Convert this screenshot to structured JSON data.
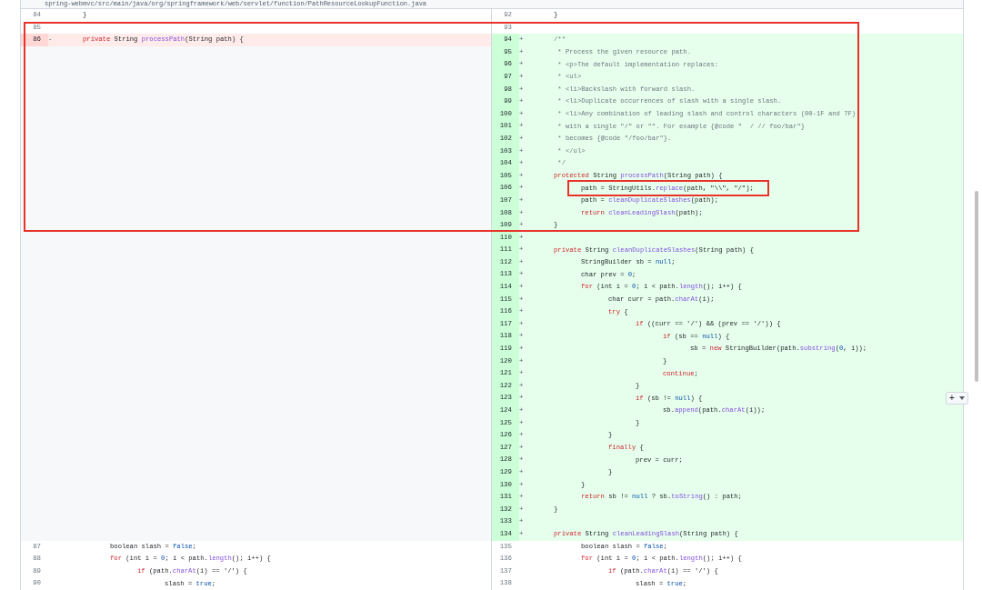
{
  "file_header": {
    "path": "spring-webmvc/src/main/java/org/springframework/web/servlet/function/PathResourceLookupFunction.java"
  },
  "rows": [
    {
      "left": {
        "kind": "context",
        "number": "84",
        "code": [
          {
            "kind": "plain",
            "text": "\t}"
          }
        ]
      },
      "right": {
        "kind": "context",
        "number": "92",
        "code": [
          {
            "kind": "plain",
            "text": "\t}"
          }
        ]
      }
    },
    {
      "left": {
        "kind": "context",
        "number": "85"
      },
      "right": {
        "kind": "context",
        "number": "93"
      }
    },
    {
      "left": {
        "kind": "deleted",
        "number": "86",
        "marker": "-",
        "code": [
          {
            "kind": "keyword",
            "text": "\tprivate"
          },
          {
            "kind": "plain",
            "text": " String "
          },
          {
            "kind": "method",
            "text": "processPath"
          },
          {
            "kind": "plain",
            "text": "(String path) {"
          }
        ]
      },
      "right": {
        "kind": "added",
        "number": "94",
        "marker": "+",
        "code": [
          {
            "kind": "comment",
            "text": "\t/**"
          }
        ]
      }
    },
    {
      "left": {
        "kind": "empty"
      },
      "right": {
        "kind": "added",
        "number": "95",
        "marker": "+",
        "code": [
          {
            "kind": "comment",
            "text": "\t * Process the given resource path."
          }
        ]
      }
    },
    {
      "left": {
        "kind": "empty"
      },
      "right": {
        "kind": "added",
        "number": "96",
        "marker": "+",
        "code": [
          {
            "kind": "comment",
            "text": "\t * <p>The default implementation replaces:"
          }
        ]
      }
    },
    {
      "left": {
        "kind": "empty"
      },
      "right": {
        "kind": "added",
        "number": "97",
        "marker": "+",
        "code": [
          {
            "kind": "comment",
            "text": "\t * <ul>"
          }
        ]
      }
    },
    {
      "left": {
        "kind": "empty"
      },
      "right": {
        "kind": "added",
        "number": "98",
        "marker": "+",
        "code": [
          {
            "kind": "comment",
            "text": "\t * <li>Backslash with forward slash."
          }
        ]
      }
    },
    {
      "left": {
        "kind": "empty"
      },
      "right": {
        "kind": "added",
        "number": "99",
        "marker": "+",
        "code": [
          {
            "kind": "comment",
            "text": "\t * <li>Duplicate occurrences of slash with a single slash."
          }
        ]
      }
    },
    {
      "left": {
        "kind": "empty"
      },
      "right": {
        "kind": "added",
        "number": "100",
        "marker": "+",
        "code": [
          {
            "kind": "comment",
            "text": "\t * <li>Any combination of leading slash and control characters (00-1F and 7F)"
          }
        ]
      }
    },
    {
      "left": {
        "kind": "empty"
      },
      "right": {
        "kind": "added",
        "number": "101",
        "marker": "+",
        "code": [
          {
            "kind": "comment",
            "text": "\t * with a single \"/\" or \"\". For example {@code \"  / // foo/bar\"}"
          }
        ]
      }
    },
    {
      "left": {
        "kind": "empty"
      },
      "right": {
        "kind": "added",
        "number": "102",
        "marker": "+",
        "code": [
          {
            "kind": "comment",
            "text": "\t * becomes {@code \"/foo/bar\"}."
          }
        ]
      }
    },
    {
      "left": {
        "kind": "empty"
      },
      "right": {
        "kind": "added",
        "number": "103",
        "marker": "+",
        "code": [
          {
            "kind": "comment",
            "text": "\t * </ul>"
          }
        ]
      }
    },
    {
      "left": {
        "kind": "empty"
      },
      "right": {
        "kind": "added",
        "number": "104",
        "marker": "+",
        "code": [
          {
            "kind": "comment",
            "text": "\t */"
          }
        ]
      }
    },
    {
      "left": {
        "kind": "empty"
      },
      "right": {
        "kind": "added",
        "number": "105",
        "marker": "+",
        "code": [
          {
            "kind": "keyword",
            "text": "\tprotected"
          },
          {
            "kind": "plain",
            "text": " String "
          },
          {
            "kind": "method",
            "text": "processPath"
          },
          {
            "kind": "plain",
            "text": "(String path) {"
          }
        ]
      }
    },
    {
      "left": {
        "kind": "empty"
      },
      "right": {
        "kind": "added",
        "number": "106",
        "marker": "+",
        "code": [
          {
            "kind": "plain",
            "text": "\t\tpath = StringUtils."
          },
          {
            "kind": "method",
            "text": "replace"
          },
          {
            "kind": "plain",
            "text": "(path, \"\\\\\", \"/\");"
          }
        ]
      }
    },
    {
      "left": {
        "kind": "empty"
      },
      "right": {
        "kind": "added",
        "number": "107",
        "marker": "+",
        "code": [
          {
            "kind": "plain",
            "text": "\t\tpath = "
          },
          {
            "kind": "method",
            "text": "cleanDuplicateSlashes"
          },
          {
            "kind": "plain",
            "text": "(path);"
          }
        ]
      }
    },
    {
      "left": {
        "kind": "empty"
      },
      "right": {
        "kind": "added",
        "number": "108",
        "marker": "+",
        "code": [
          {
            "kind": "keyword",
            "text": "\t\treturn "
          },
          {
            "kind": "method",
            "text": "cleanLeadingSlash"
          },
          {
            "kind": "plain",
            "text": "(path);"
          }
        ]
      }
    },
    {
      "left": {
        "kind": "empty"
      },
      "right": {
        "kind": "added",
        "number": "109",
        "marker": "+",
        "code": [
          {
            "kind": "plain",
            "text": "\t}"
          }
        ]
      }
    },
    {
      "left": {
        "kind": "empty"
      },
      "right": {
        "kind": "added",
        "number": "110",
        "marker": "+"
      }
    },
    {
      "left": {
        "kind": "empty"
      },
      "right": {
        "kind": "added",
        "number": "111",
        "marker": "+",
        "code": [
          {
            "kind": "keyword",
            "text": "\tprivate"
          },
          {
            "kind": "plain",
            "text": " String "
          },
          {
            "kind": "method",
            "text": "cleanDuplicateSlashes"
          },
          {
            "kind": "plain",
            "text": "(String path) {"
          }
        ]
      }
    },
    {
      "left": {
        "kind": "empty"
      },
      "right": {
        "kind": "added",
        "number": "112",
        "marker": "+",
        "code": [
          {
            "kind": "plain",
            "text": "\t\tStringBuilder sb = "
          },
          {
            "kind": "constant",
            "text": "null"
          },
          {
            "kind": "plain",
            "text": ";"
          }
        ]
      }
    },
    {
      "left": {
        "kind": "empty"
      },
      "right": {
        "kind": "added",
        "number": "113",
        "marker": "+",
        "code": [
          {
            "kind": "plain",
            "text": "\t\tchar prev = "
          },
          {
            "kind": "constant",
            "text": "0"
          },
          {
            "kind": "plain",
            "text": ";"
          }
        ]
      }
    },
    {
      "left": {
        "kind": "empty"
      },
      "right": {
        "kind": "added",
        "number": "114",
        "marker": "+",
        "code": [
          {
            "kind": "keyword",
            "text": "\t\tfor"
          },
          {
            "kind": "plain",
            "text": " (int i = "
          },
          {
            "kind": "constant",
            "text": "0"
          },
          {
            "kind": "plain",
            "text": "; i < path."
          },
          {
            "kind": "method",
            "text": "length"
          },
          {
            "kind": "plain",
            "text": "(); i++) {"
          }
        ]
      }
    },
    {
      "left": {
        "kind": "empty"
      },
      "right": {
        "kind": "added",
        "number": "115",
        "marker": "+",
        "code": [
          {
            "kind": "plain",
            "text": "\t\t\tchar curr = path."
          },
          {
            "kind": "method",
            "text": "charAt"
          },
          {
            "kind": "plain",
            "text": "(i);"
          }
        ]
      }
    },
    {
      "left": {
        "kind": "empty"
      },
      "right": {
        "kind": "added",
        "number": "116",
        "marker": "+",
        "code": [
          {
            "kind": "keyword",
            "text": "\t\t\ttry"
          },
          {
            "kind": "plain",
            "text": " {"
          }
        ]
      }
    },
    {
      "left": {
        "kind": "empty"
      },
      "right": {
        "kind": "added",
        "number": "117",
        "marker": "+",
        "code": [
          {
            "kind": "keyword",
            "text": "\t\t\t\tif"
          },
          {
            "kind": "plain",
            "text": " ((curr == '/') && (prev == '/')) {"
          }
        ]
      }
    },
    {
      "left": {
        "kind": "empty"
      },
      "right": {
        "kind": "added",
        "number": "118",
        "marker": "+",
        "code": [
          {
            "kind": "keyword",
            "text": "\t\t\t\t\tif"
          },
          {
            "kind": "plain",
            "text": " (sb == "
          },
          {
            "kind": "constant",
            "text": "null"
          },
          {
            "kind": "plain",
            "text": ") {"
          }
        ]
      }
    },
    {
      "left": {
        "kind": "empty"
      },
      "right": {
        "kind": "added",
        "number": "119",
        "marker": "+",
        "code": [
          {
            "kind": "plain",
            "text": "\t\t\t\t\t\tsb = "
          },
          {
            "kind": "keyword",
            "text": "new"
          },
          {
            "kind": "plain",
            "text": " StringBuilder(path."
          },
          {
            "kind": "method",
            "text": "substring"
          },
          {
            "kind": "plain",
            "text": "("
          },
          {
            "kind": "constant",
            "text": "0"
          },
          {
            "kind": "plain",
            "text": ", i));"
          }
        ]
      }
    },
    {
      "left": {
        "kind": "empty"
      },
      "right": {
        "kind": "added",
        "number": "120",
        "marker": "+",
        "code": [
          {
            "kind": "plain",
            "text": "\t\t\t\t\t}"
          }
        ]
      }
    },
    {
      "left": {
        "kind": "empty"
      },
      "right": {
        "kind": "added",
        "number": "121",
        "marker": "+",
        "code": [
          {
            "kind": "keyword",
            "text": "\t\t\t\t\tcontinue"
          },
          {
            "kind": "plain",
            "text": ";"
          }
        ]
      }
    },
    {
      "left": {
        "kind": "empty"
      },
      "right": {
        "kind": "added",
        "number": "122",
        "marker": "+",
        "code": [
          {
            "kind": "plain",
            "text": "\t\t\t\t}"
          }
        ]
      }
    },
    {
      "left": {
        "kind": "empty"
      },
      "right": {
        "kind": "added",
        "number": "123",
        "marker": "+",
        "code": [
          {
            "kind": "keyword",
            "text": "\t\t\t\tif"
          },
          {
            "kind": "plain",
            "text": " (sb != "
          },
          {
            "kind": "constant",
            "text": "null"
          },
          {
            "kind": "plain",
            "text": ") {"
          }
        ]
      }
    },
    {
      "left": {
        "kind": "empty"
      },
      "right": {
        "kind": "added",
        "number": "124",
        "marker": "+",
        "code": [
          {
            "kind": "plain",
            "text": "\t\t\t\t\tsb."
          },
          {
            "kind": "method",
            "text": "append"
          },
          {
            "kind": "plain",
            "text": "(path."
          },
          {
            "kind": "method",
            "text": "charAt"
          },
          {
            "kind": "plain",
            "text": "(i));"
          }
        ]
      }
    },
    {
      "left": {
        "kind": "empty"
      },
      "right": {
        "kind": "added",
        "number": "125",
        "marker": "+",
        "code": [
          {
            "kind": "plain",
            "text": "\t\t\t\t}"
          }
        ]
      }
    },
    {
      "left": {
        "kind": "empty"
      },
      "right": {
        "kind": "added",
        "number": "126",
        "marker": "+",
        "code": [
          {
            "kind": "plain",
            "text": "\t\t\t}"
          }
        ]
      }
    },
    {
      "left": {
        "kind": "empty"
      },
      "right": {
        "kind": "added",
        "number": "127",
        "marker": "+",
        "code": [
          {
            "kind": "keyword",
            "text": "\t\t\tfinally"
          },
          {
            "kind": "plain",
            "text": " {"
          }
        ]
      }
    },
    {
      "left": {
        "kind": "empty"
      },
      "right": {
        "kind": "added",
        "number": "128",
        "marker": "+",
        "code": [
          {
            "kind": "plain",
            "text": "\t\t\t\tprev = curr;"
          }
        ]
      }
    },
    {
      "left": {
        "kind": "empty"
      },
      "right": {
        "kind": "added",
        "number": "129",
        "marker": "+",
        "code": [
          {
            "kind": "plain",
            "text": "\t\t\t}"
          }
        ]
      }
    },
    {
      "left": {
        "kind": "empty"
      },
      "right": {
        "kind": "added",
        "number": "130",
        "marker": "+",
        "code": [
          {
            "kind": "plain",
            "text": "\t\t}"
          }
        ]
      }
    },
    {
      "left": {
        "kind": "empty"
      },
      "right": {
        "kind": "added",
        "number": "131",
        "marker": "+",
        "code": [
          {
            "kind": "keyword",
            "text": "\t\treturn"
          },
          {
            "kind": "plain",
            "text": " sb != "
          },
          {
            "kind": "constant",
            "text": "null"
          },
          {
            "kind": "plain",
            "text": " ? sb."
          },
          {
            "kind": "method",
            "text": "toString"
          },
          {
            "kind": "plain",
            "text": "() : path;"
          }
        ]
      }
    },
    {
      "left": {
        "kind": "empty"
      },
      "right": {
        "kind": "added",
        "number": "132",
        "marker": "+",
        "code": [
          {
            "kind": "plain",
            "text": "\t}"
          }
        ]
      }
    },
    {
      "left": {
        "kind": "empty"
      },
      "right": {
        "kind": "added",
        "number": "133",
        "marker": "+"
      }
    },
    {
      "left": {
        "kind": "empty"
      },
      "right": {
        "kind": "added",
        "number": "134",
        "marker": "+",
        "code": [
          {
            "kind": "keyword",
            "text": "\tprivate"
          },
          {
            "kind": "plain",
            "text": " String "
          },
          {
            "kind": "method",
            "text": "cleanLeadingSlash"
          },
          {
            "kind": "plain",
            "text": "(String path) {"
          }
        ]
      }
    },
    {
      "left": {
        "kind": "context",
        "number": "87",
        "code": [
          {
            "kind": "plain",
            "text": "\t\tboolean slash = "
          },
          {
            "kind": "constant",
            "text": "false"
          },
          {
            "kind": "plain",
            "text": ";"
          }
        ]
      },
      "right": {
        "kind": "context",
        "number": "135",
        "code": [
          {
            "kind": "plain",
            "text": "\t\tboolean slash = "
          },
          {
            "kind": "constant",
            "text": "false"
          },
          {
            "kind": "plain",
            "text": ";"
          }
        ]
      }
    },
    {
      "left": {
        "kind": "context",
        "number": "88",
        "code": [
          {
            "kind": "keyword",
            "text": "\t\tfor"
          },
          {
            "kind": "plain",
            "text": " (int i = "
          },
          {
            "kind": "constant",
            "text": "0"
          },
          {
            "kind": "plain",
            "text": "; i < path."
          },
          {
            "kind": "method",
            "text": "length"
          },
          {
            "kind": "plain",
            "text": "(); i++) {"
          }
        ]
      },
      "right": {
        "kind": "context",
        "number": "136",
        "code": [
          {
            "kind": "keyword",
            "text": "\t\tfor"
          },
          {
            "kind": "plain",
            "text": " (int i = "
          },
          {
            "kind": "constant",
            "text": "0"
          },
          {
            "kind": "plain",
            "text": "; i < path."
          },
          {
            "kind": "method",
            "text": "length"
          },
          {
            "kind": "plain",
            "text": "(); i++) {"
          }
        ]
      }
    },
    {
      "left": {
        "kind": "context",
        "number": "89",
        "code": [
          {
            "kind": "keyword",
            "text": "\t\t\tif"
          },
          {
            "kind": "plain",
            "text": " (path."
          },
          {
            "kind": "method",
            "text": "charAt"
          },
          {
            "kind": "plain",
            "text": "(i) == '/') {"
          }
        ]
      },
      "right": {
        "kind": "context",
        "number": "137",
        "code": [
          {
            "kind": "keyword",
            "text": "\t\t\tif"
          },
          {
            "kind": "plain",
            "text": " (path."
          },
          {
            "kind": "method",
            "text": "charAt"
          },
          {
            "kind": "plain",
            "text": "(i) == '/') {"
          }
        ]
      }
    },
    {
      "left": {
        "kind": "context",
        "number": "90",
        "code": [
          {
            "kind": "plain",
            "text": "\t\t\t\tslash = "
          },
          {
            "kind": "constant",
            "text": "true"
          },
          {
            "kind": "plain",
            "text": ";"
          }
        ]
      },
      "right": {
        "kind": "context",
        "number": "138",
        "code": [
          {
            "kind": "plain",
            "text": "\t\t\t\tslash = "
          },
          {
            "kind": "constant",
            "text": "true"
          },
          {
            "kind": "plain",
            "text": ";"
          }
        ]
      }
    }
  ],
  "add_button": {
    "label": "+"
  }
}
